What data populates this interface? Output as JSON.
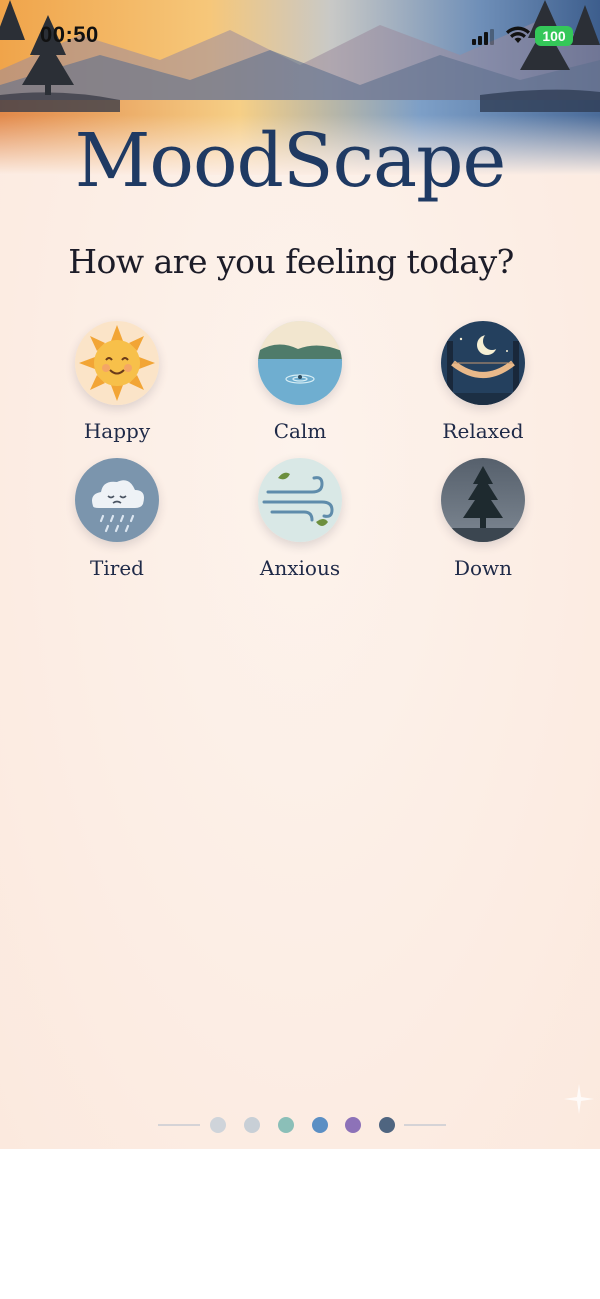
{
  "status_bar": {
    "time": "00:50",
    "battery": "100",
    "battery_color": "#34c759"
  },
  "app": {
    "title": "MoodScape",
    "prompt": "How are you feeling today?",
    "title_color": "#1f3a63"
  },
  "moods": [
    {
      "label": "Happy",
      "icon": "sun-face-icon"
    },
    {
      "label": "Calm",
      "icon": "lake-icon"
    },
    {
      "label": "Relaxed",
      "icon": "hammock-moon-icon"
    },
    {
      "label": "Tired",
      "icon": "rain-cloud-face-icon"
    },
    {
      "label": "Anxious",
      "icon": "wind-leaves-icon"
    },
    {
      "label": "Down",
      "icon": "pine-tree-icon"
    }
  ],
  "pager": {
    "dot_colors": [
      "#cfd4da",
      "#c8cfd6",
      "#8bbfb8",
      "#5b8fc4",
      "#8d72b8",
      "#4f6580"
    ]
  }
}
